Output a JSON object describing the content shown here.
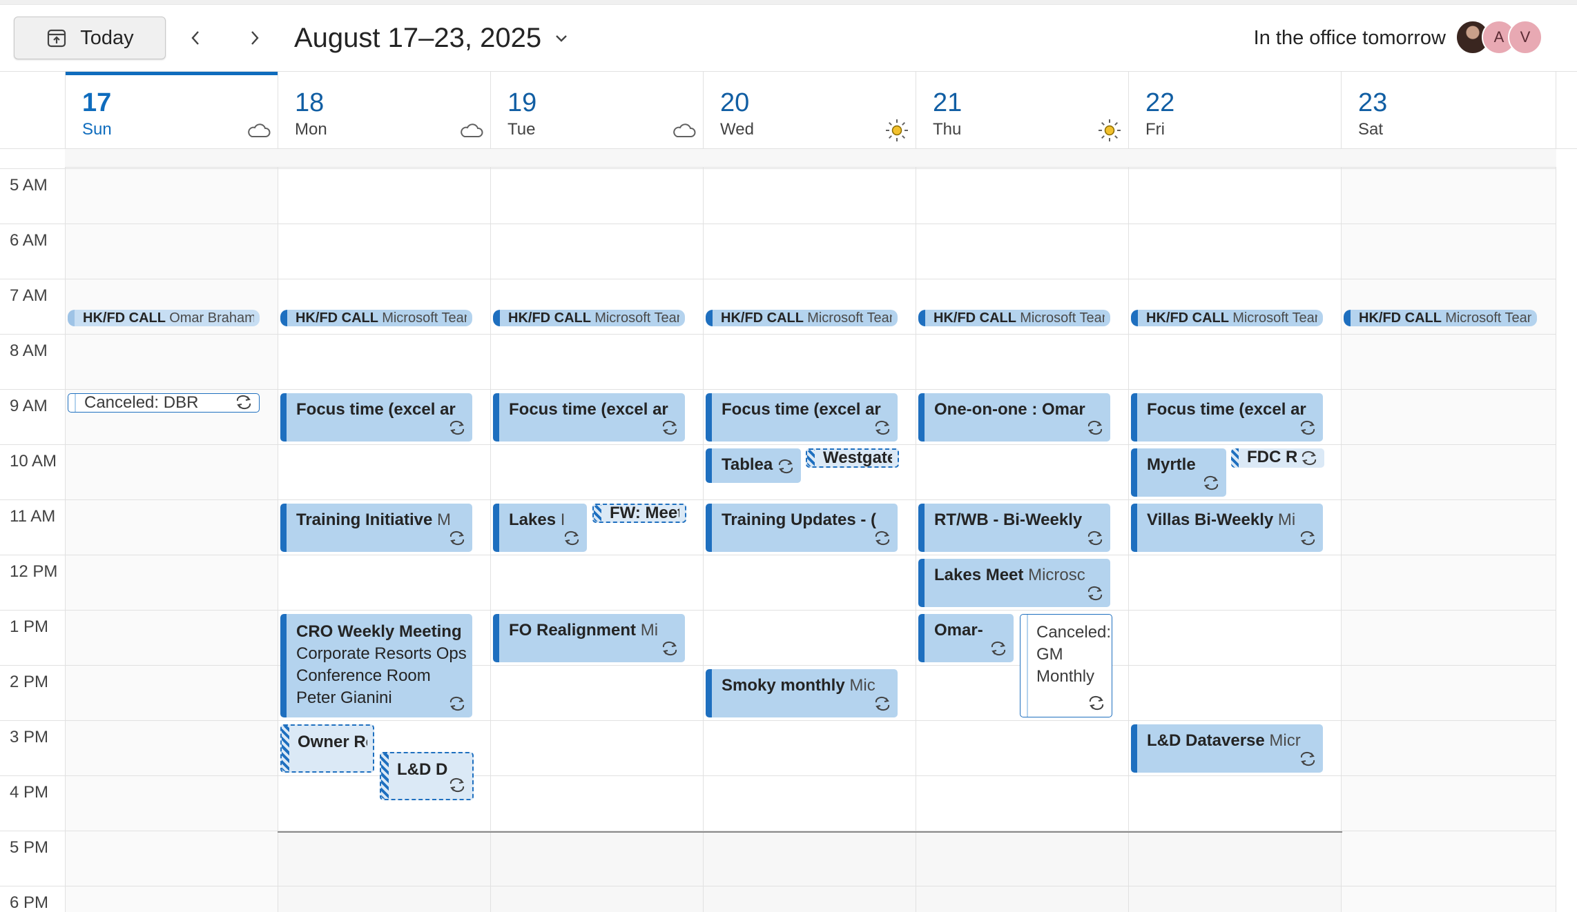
{
  "toolbar": {
    "today_label": "Today",
    "date_range": "August 17–23, 2025",
    "office_label": "In the office tomorrow",
    "avatars": [
      "A",
      "V"
    ]
  },
  "days": [
    {
      "num": "17",
      "weekday": "Sun",
      "weather": "cloud-icon",
      "today": true
    },
    {
      "num": "18",
      "weekday": "Mon",
      "weather": "cloud-icon"
    },
    {
      "num": "19",
      "weekday": "Tue",
      "weather": "cloud-icon"
    },
    {
      "num": "20",
      "weekday": "Wed",
      "weather": "sun-icon"
    },
    {
      "num": "21",
      "weekday": "Thu",
      "weather": "sun-icon"
    },
    {
      "num": "22",
      "weekday": "Fri",
      "weather": ""
    },
    {
      "num": "23",
      "weekday": "Sat",
      "weather": ""
    }
  ],
  "hours": [
    "5 AM",
    "6 AM",
    "7 AM",
    "8 AM",
    "9 AM",
    "10 AM",
    "11 AM",
    "12 PM",
    "1 PM",
    "2 PM",
    "3 PM",
    "4 PM",
    "5 PM",
    "6 PM"
  ],
  "events": {
    "hk_sun": {
      "title": "HK/FD CALL",
      "sub": "Omar Braham"
    },
    "hk_mon": {
      "title": "HK/FD CALL",
      "sub": "Microsoft Tean"
    },
    "hk_tue": {
      "title": "HK/FD CALL",
      "sub": "Microsoft Tean"
    },
    "hk_wed": {
      "title": "HK/FD CALL",
      "sub": "Microsoft Tean"
    },
    "hk_thu": {
      "title": "HK/FD CALL",
      "sub": "Microsoft Tean"
    },
    "hk_fri": {
      "title": "HK/FD CALL",
      "sub": "Microsoft Tean"
    },
    "hk_sat": {
      "title": "HK/FD CALL",
      "sub": "Microsoft Tean"
    },
    "canceled_dbr": {
      "title": "Canceled: DBR"
    },
    "focus_mon": {
      "title": "Focus time (excel ar"
    },
    "focus_tue": {
      "title": "Focus time (excel ar"
    },
    "focus_wed": {
      "title": "Focus time (excel ar"
    },
    "oneonone_thu": {
      "title": "One-on-one : Omar"
    },
    "focus_fri": {
      "title": "Focus time (excel ar"
    },
    "tablea_wed": {
      "title": "Tablea"
    },
    "westgate_wed": {
      "title": "Westgate"
    },
    "myrtle_fri": {
      "title": "Myrtle"
    },
    "fdc_fri": {
      "title": "FDC R"
    },
    "training_mon": {
      "title": "Training Initiative",
      "sub": "M"
    },
    "lakes_tue": {
      "title": "Lakes",
      "sub": "I"
    },
    "fwmeet_tue": {
      "title": "FW: Meet"
    },
    "trainingupd_wed": {
      "title": "Training Updates - ("
    },
    "rtwb_thu": {
      "title": "RT/WB - Bi-Weekly"
    },
    "villas_fri": {
      "title": "Villas Bi-Weekly",
      "sub": "Mi"
    },
    "lakesmeet_thu": {
      "title": "Lakes Meet",
      "sub": "Microsc"
    },
    "cro_mon": {
      "line1": "CRO Weekly Meeting",
      "line2": "Corporate Resorts Ops",
      "line3": "Conference Room",
      "line4": "Peter Gianini"
    },
    "fo_tue": {
      "title": "FO Realignment",
      "sub": "Mi"
    },
    "omar_thu": {
      "title": "Omar-"
    },
    "gm_thu": {
      "line1": "Canceled:",
      "line2": "GM",
      "line3": "Monthly"
    },
    "smoky_wed": {
      "title": "Smoky monthly",
      "sub": "Mic"
    },
    "owner_mon": {
      "title": "Owner Re"
    },
    "ld_mon": {
      "title": "L&D D"
    },
    "ld_fri": {
      "title": "L&D Dataverse",
      "sub": "Micr"
    }
  }
}
